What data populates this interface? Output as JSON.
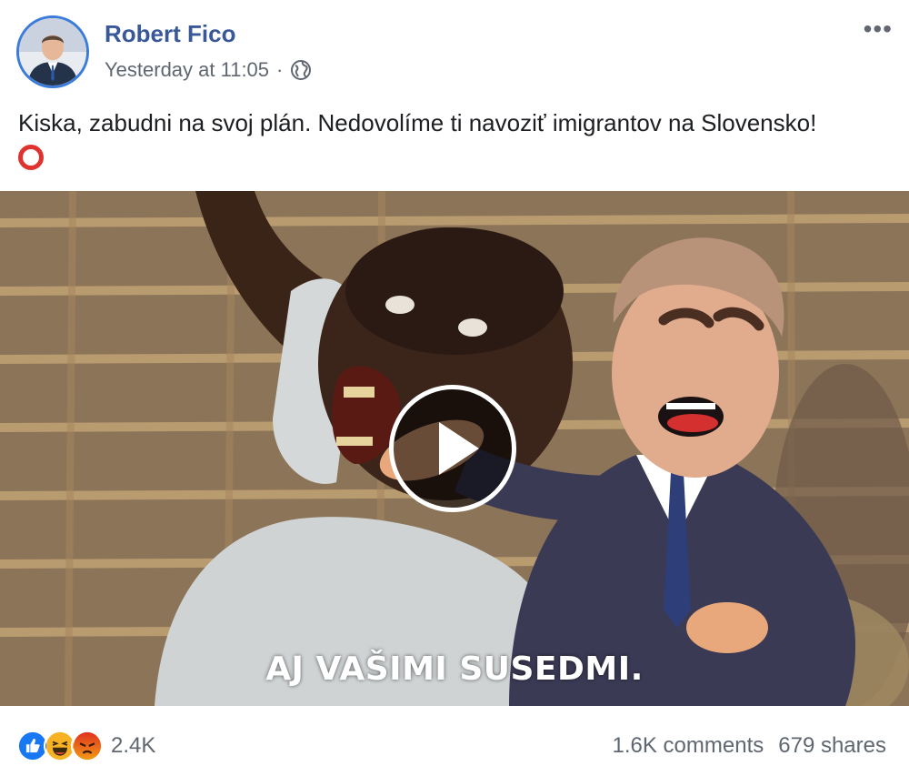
{
  "header": {
    "author": "Robert Fico",
    "timestamp": "Yesterday at 11:05",
    "separator": "·",
    "privacy_icon": "globe-icon",
    "more_label": "•••"
  },
  "post": {
    "text": "Kiska, zabudni na svoj plán. Nedovolíme ti navoziť imigrantov na Slovensko!",
    "emoji": "heavy-large-circle"
  },
  "video": {
    "subtitle": "AJ VAŠIMI SUSEDMI.",
    "play_icon": "play-icon"
  },
  "footer": {
    "reactions": [
      "like",
      "haha",
      "angry"
    ],
    "reaction_count": "2.4K",
    "comments": "1.6K comments",
    "shares": "679 shares"
  },
  "colors": {
    "author_link": "#385898",
    "meta_text": "#606770",
    "like_blue": "#1877f2",
    "haha_yellow": "#f7b125",
    "angry_orange": "#e9710f",
    "ring_red": "#e0322e"
  }
}
